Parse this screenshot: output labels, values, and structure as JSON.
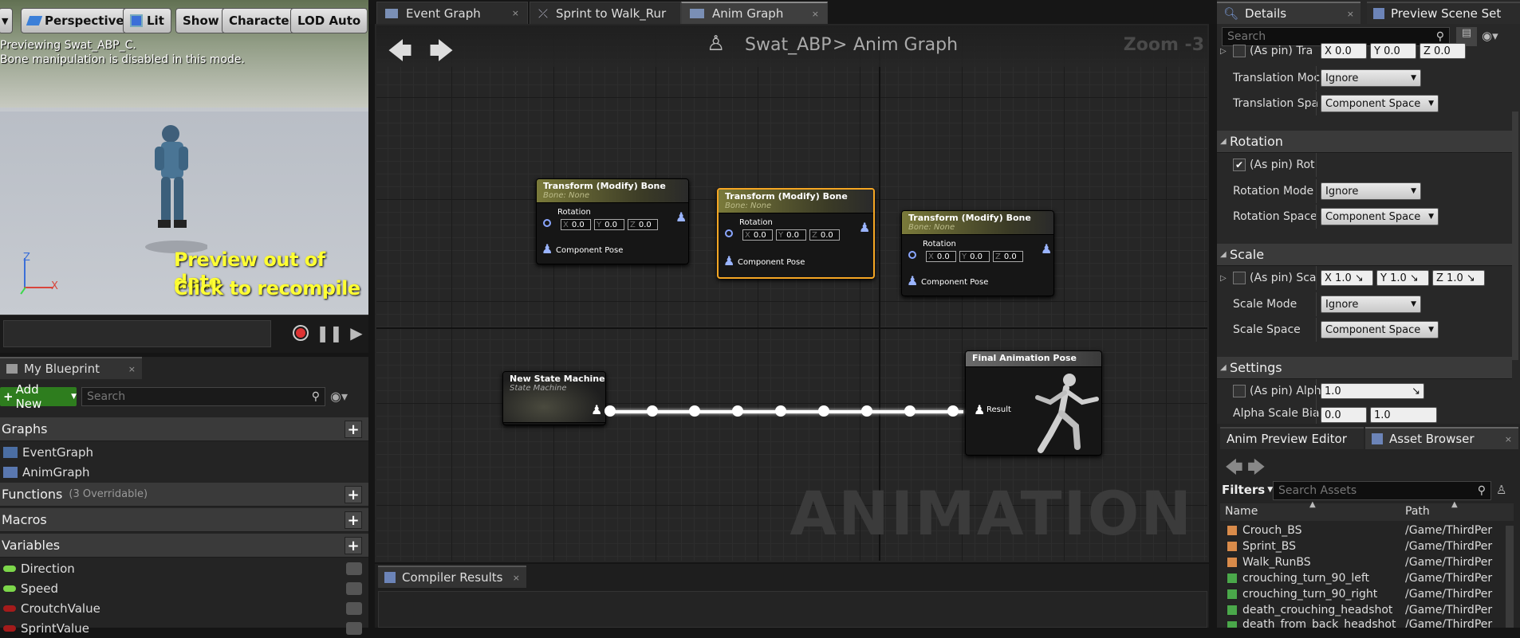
{
  "viewport": {
    "buttons": {
      "menu": "▼",
      "perspective": "Perspective",
      "lit": "Lit",
      "show": "Show",
      "character": "Character",
      "lod": "LOD Auto"
    },
    "previewing": "Previewing Swat_ABP_C.",
    "bone_note": "Bone manipulation is disabled in this mode.",
    "stale_line1": "Preview out of date",
    "stale_line2": "Click to recompile",
    "axis_z": "Z",
    "axis_x": "X"
  },
  "my_blueprint": {
    "tab": "My Blueprint",
    "add_new": "Add New",
    "search_placeholder": "Search",
    "graphs_label": "Graphs",
    "graphs": [
      "EventGraph",
      "AnimGraph"
    ],
    "functions_label": "Functions",
    "functions_note": "(3 Overridable)",
    "macros_label": "Macros",
    "variables_label": "Variables",
    "variables": [
      {
        "name": "Direction",
        "color": "#7cd64a"
      },
      {
        "name": "Speed",
        "color": "#7cd64a"
      },
      {
        "name": "CroutchValue",
        "color": "#a41b1b"
      },
      {
        "name": "SprintValue",
        "color": "#a41b1b"
      }
    ]
  },
  "tabs": [
    {
      "label": "Event Graph",
      "icon": "graph-icon"
    },
    {
      "label": "Sprint to Walk_Rur",
      "icon": "transition-icon"
    },
    {
      "label": "Anim Graph",
      "icon": "anim-graph-icon"
    }
  ],
  "graph": {
    "breadcrumb_root": "Swat_ABP",
    "breadcrumb_sep": ">",
    "breadcrumb_leaf": "Anim Graph",
    "zoom": "Zoom -3",
    "watermark": "ANIMATION",
    "transform_nodes": [
      {
        "title": "Transform (Modify) Bone",
        "sub": "Bone: None",
        "pin_label": "Rotation",
        "x": "0.0",
        "y": "0.0",
        "z": "0.0",
        "pose": "Component Pose"
      },
      {
        "title": "Transform (Modify) Bone",
        "sub": "Bone: None",
        "pin_label": "Rotation",
        "x": "0.0",
        "y": "0.0",
        "z": "0.0",
        "pose": "Component Pose"
      },
      {
        "title": "Transform (Modify) Bone",
        "sub": "Bone: None",
        "pin_label": "Rotation",
        "x": "0.0",
        "y": "0.0",
        "z": "0.0",
        "pose": "Component Pose"
      }
    ],
    "state_machine": {
      "title": "New State Machine",
      "sub": "State Machine"
    },
    "final_pose": {
      "title": "Final Animation Pose",
      "result": "Result"
    }
  },
  "compiler": {
    "tab": "Compiler Results"
  },
  "details": {
    "tab": "Details",
    "preview_tab": "Preview Scene Set",
    "search_placeholder": "Search",
    "top_row": {
      "label": "(As pin) Tra",
      "x": "0.0",
      "y": "0.0",
      "z": "0.0"
    },
    "translation_mode_label": "Translation Moc",
    "translation_mode": "Ignore",
    "translation_space_label": "Translation Spa",
    "translation_space": "Component Space",
    "rotation_cat": "Rotation",
    "rot_pin": "(As pin) Rot",
    "rotation_mode_label": "Rotation Mode",
    "rotation_mode": "Ignore",
    "rotation_space_label": "Rotation Space",
    "rotation_space": "Component Space",
    "scale_cat": "Scale",
    "scale_pin": "(As pin) Sca",
    "scale_x": "1.0",
    "scale_y": "1.0",
    "scale_z": "1.0",
    "scale_mode_label": "Scale Mode",
    "scale_mode": "Ignore",
    "scale_space_label": "Scale Space",
    "scale_space": "Component Space",
    "settings_cat": "Settings",
    "alpha_pin": "(As pin) Alph",
    "alpha_value": "1.0",
    "alpha_bias_label": "Alpha Scale Bia",
    "alpha_bias_min": "0.0",
    "alpha_bias_max": "1.0"
  },
  "asset_browser": {
    "tab_preview": "Anim Preview Editor",
    "tab_assets": "Asset Browser",
    "filters": "Filters",
    "search_placeholder": "Search Assets",
    "col_name": "Name",
    "col_path": "Path",
    "rows": [
      {
        "name": "Crouch_BS",
        "path": "/Game/ThirdPer",
        "color": "#d98b4a"
      },
      {
        "name": "Sprint_BS",
        "path": "/Game/ThirdPer",
        "color": "#d98b4a"
      },
      {
        "name": "Walk_RunBS",
        "path": "/Game/ThirdPer",
        "color": "#d98b4a"
      },
      {
        "name": "crouching_turn_90_left",
        "path": "/Game/ThirdPer",
        "color": "#4aa84a"
      },
      {
        "name": "crouching_turn_90_right",
        "path": "/Game/ThirdPer",
        "color": "#4aa84a"
      },
      {
        "name": "death_crouching_headshot_",
        "path": "/Game/ThirdPer",
        "color": "#4aa84a"
      },
      {
        "name": "death_from_back_headshot",
        "path": "/Game/ThirdPer",
        "color": "#4aa84a"
      }
    ]
  }
}
